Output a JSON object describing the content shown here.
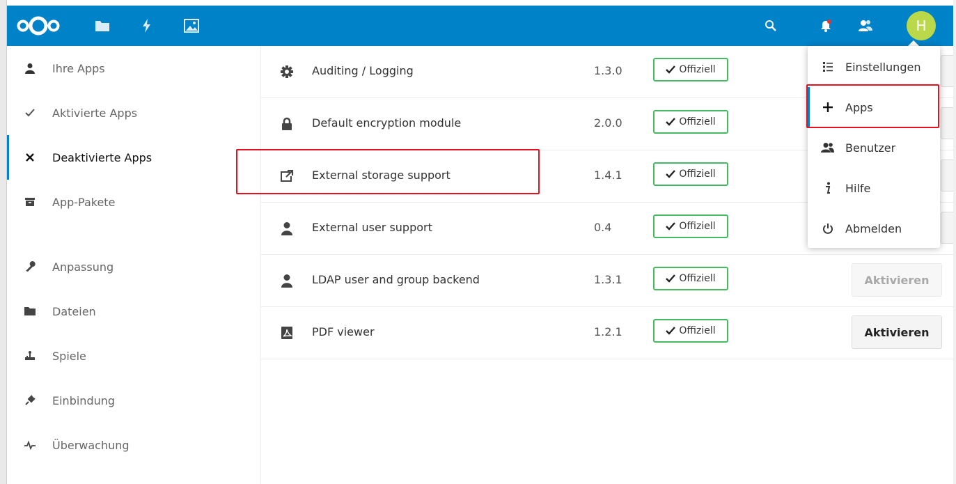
{
  "header": {
    "avatar_letter": "H",
    "brand_color": "#0082c9",
    "icons": [
      "nextcloud-logo",
      "files-icon",
      "activity-icon",
      "gallery-icon",
      "search-icon",
      "notifications-icon",
      "contacts-icon"
    ]
  },
  "sidebar": {
    "items": [
      {
        "label": "Ihre Apps",
        "icon": "user-icon"
      },
      {
        "label": "Aktivierte Apps",
        "icon": "check-icon"
      },
      {
        "label": "Deaktivierte Apps",
        "icon": "close-icon",
        "active": true
      },
      {
        "label": "App-Pakete",
        "icon": "archive-icon"
      },
      {
        "label": "Anpassung",
        "icon": "wrench-icon"
      },
      {
        "label": "Dateien",
        "icon": "folder-icon"
      },
      {
        "label": "Spiele",
        "icon": "game-icon"
      },
      {
        "label": "Einbindung",
        "icon": "plug-icon"
      },
      {
        "label": "Überwachung",
        "icon": "monitoring-icon"
      }
    ]
  },
  "apps": [
    {
      "name": "Auditing / Logging",
      "version": "1.3.0",
      "badge": "Offiziell",
      "icon": "gear-icon"
    },
    {
      "name": "Default encryption module",
      "version": "2.0.0",
      "badge": "Offiziell",
      "icon": "lock-icon"
    },
    {
      "name": "External storage support",
      "version": "1.4.1",
      "badge": "Offiziell",
      "icon": "external-link-icon",
      "highlighted": true
    },
    {
      "name": "External user support",
      "version": "0.4",
      "badge": "Offiziell",
      "icon": "user-icon"
    },
    {
      "name": "LDAP user and group backend",
      "version": "1.3.1",
      "badge": "Offiziell",
      "icon": "user-icon",
      "action": "Aktivieren",
      "action_disabled": true
    },
    {
      "name": "PDF viewer",
      "version": "1.2.1",
      "badge": "Offiziell",
      "icon": "pdf-icon",
      "action": "Aktivieren",
      "action_disabled": false
    }
  ],
  "menu": {
    "items": [
      {
        "label": "Einstellungen",
        "icon": "settings-list-icon"
      },
      {
        "label": "Apps",
        "icon": "plus-icon",
        "active": true
      },
      {
        "label": "Benutzer",
        "icon": "users-icon"
      },
      {
        "label": "Hilfe",
        "icon": "info-icon"
      },
      {
        "label": "Abmelden",
        "icon": "power-icon"
      }
    ]
  },
  "colors": {
    "badge_border": "#46ba61",
    "highlight": "#e8101e",
    "avatar_bg": "#b9d84a"
  }
}
